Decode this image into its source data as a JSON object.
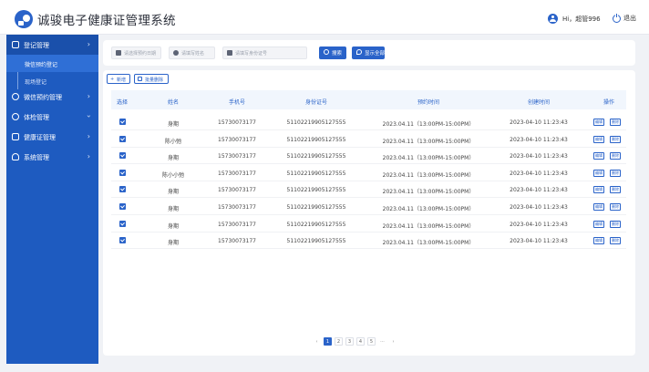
{
  "header": {
    "title": "诚骏电子健康证管理系统",
    "greeting": "Hi，超管996",
    "logout": "退出"
  },
  "sidebar": {
    "items": [
      {
        "label": "登记管理",
        "icon": "register-icon",
        "expanded": true
      },
      {
        "label": "微信预约管理",
        "icon": "wechat-icon"
      },
      {
        "label": "体检管理",
        "icon": "exam-icon",
        "expanded": true
      },
      {
        "label": "健康证管理",
        "icon": "certificate-icon"
      },
      {
        "label": "系统管理",
        "icon": "user-icon"
      }
    ],
    "subitems": [
      {
        "label": "微信预约登记",
        "active": true
      },
      {
        "label": "现场登记",
        "active": false
      }
    ]
  },
  "filters": {
    "date_placeholder": "请选择预约日期",
    "name_placeholder": "请填写姓名",
    "id_placeholder": "请填写身份证号",
    "search_label": "搜索",
    "show_all_label": "显示全部"
  },
  "toolbar": {
    "add_label": "新增",
    "batch_delete_label": "批量删除"
  },
  "table": {
    "headers": [
      "选择",
      "姓名",
      "手机号",
      "身份证号",
      "预约时间",
      "创建时间",
      "操作"
    ],
    "rows": [
      {
        "checked": true,
        "name": "身期",
        "phone": "15730073177",
        "id": "51102219905127555",
        "booking": "2023.04.11（13:00PM-15:00PM）",
        "created": "2023-04-10  11:23:43"
      },
      {
        "checked": true,
        "name": "陈小弛",
        "phone": "15730073177",
        "id": "51102219905127555",
        "booking": "2023.04.11（13:00PM-15:00PM）",
        "created": "2023-04-10  11:23:43"
      },
      {
        "checked": true,
        "name": "身期",
        "phone": "15730073177",
        "id": "51102219905127555",
        "booking": "2023.04.11（13:00PM-15:00PM）",
        "created": "2023-04-10  11:23:43"
      },
      {
        "checked": true,
        "name": "陈小小弛",
        "phone": "15730073177",
        "id": "51102219905127555",
        "booking": "2023.04.11（13:00PM-15:00PM）",
        "created": "2023-04-10  11:23:43"
      },
      {
        "checked": true,
        "name": "身期",
        "phone": "15730073177",
        "id": "51102219905127555",
        "booking": "2023.04.11（13:00PM-15:00PM）",
        "created": "2023-04-10  11:23:43"
      },
      {
        "checked": true,
        "name": "身期",
        "phone": "15730073177",
        "id": "51102219905127555",
        "booking": "2023.04.11（13:00PM-15:00PM）",
        "created": "2023-04-10  11:23:43"
      },
      {
        "checked": true,
        "name": "身期",
        "phone": "15730073177",
        "id": "51102219905127555",
        "booking": "2023.04.11（13:00PM-15:00PM）",
        "created": "2023-04-10  11:23:43"
      },
      {
        "checked": true,
        "name": "身期",
        "phone": "15730073177",
        "id": "51102219905127555",
        "booking": "2023.04.11（13:00PM-15:00PM）",
        "created": "2023-04-10  11:23:43"
      }
    ],
    "edit_label": "编辑",
    "delete_label": "删除"
  },
  "pagination": {
    "prev": "‹",
    "pages": [
      "1",
      "2",
      "3",
      "4",
      "5"
    ],
    "current": "1",
    "ellipsis": "···",
    "next": "›"
  },
  "colors": {
    "primary": "#2a63c9",
    "sidebar": "#1e5bc0",
    "background": "#f0f2f6"
  }
}
